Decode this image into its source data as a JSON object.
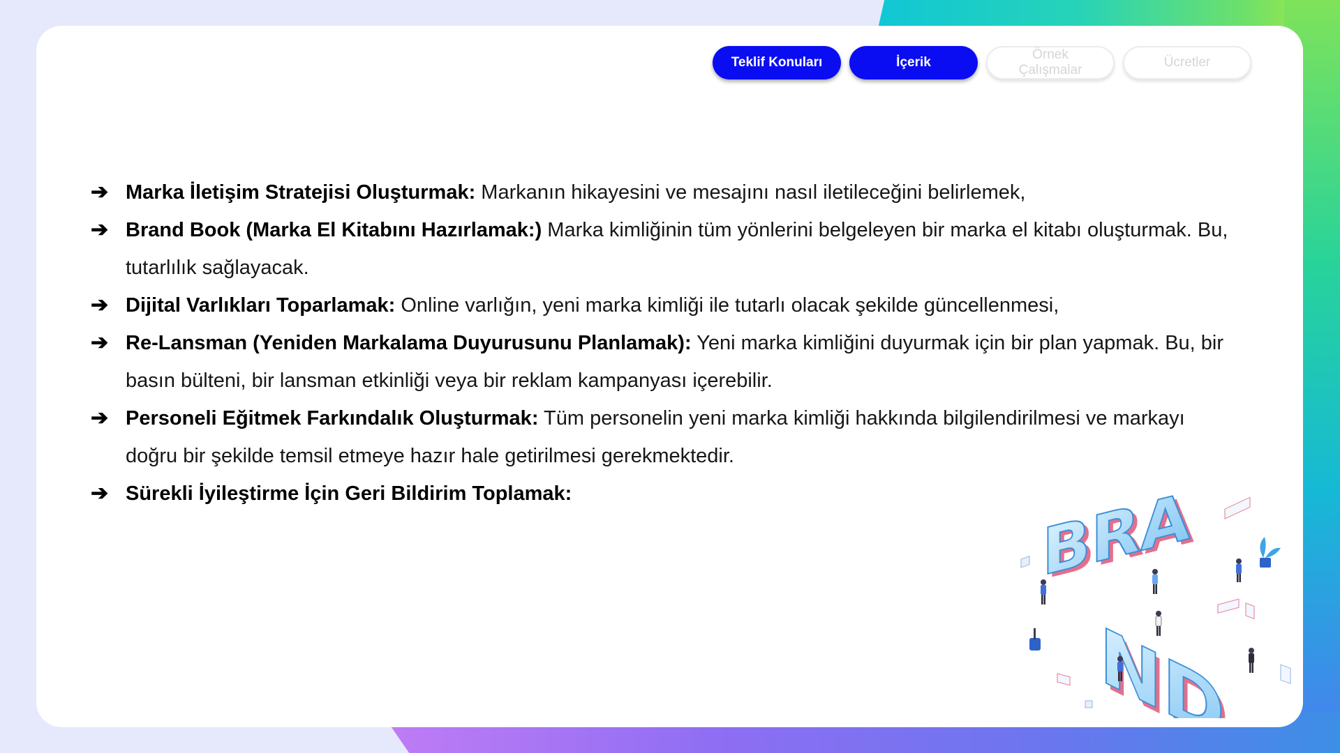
{
  "nav": {
    "tabs": [
      {
        "label": "Teklif Konuları",
        "active": true
      },
      {
        "label": "İçerik",
        "active": true
      },
      {
        "label": "Örnek\nÇalışmalar",
        "active": false
      },
      {
        "label": "Ücretler",
        "active": false
      }
    ]
  },
  "content": {
    "items": [
      {
        "bold": "Marka İletişim Stratejisi Oluşturmak:",
        "text": " Markanın hikayesini ve mesajını nasıl iletileceğini belirlemek,"
      },
      {
        "bold": "Brand Book (Marka El Kitabını Hazırlamak:)",
        "text": " Marka kimliğinin tüm yönlerini belgeleyen bir marka el kitabı oluşturmak. Bu, tutarlılık sağlayacak."
      },
      {
        "bold": "Dijital Varlıkları Toparlamak:",
        "text": " Online varlığın, yeni marka kimliği ile tutarlı olacak şekilde güncellenmesi,"
      },
      {
        "bold": "Re-Lansman (Yeniden Markalama Duyurusunu Planlamak):",
        "text": " Yeni marka kimliğini duyurmak için bir plan yapmak. Bu, bir basın bülteni, bir lansman etkinliği veya bir reklam kampanyası içerebilir."
      },
      {
        "bold": "Personeli Eğitmek Farkındalık Oluşturmak:",
        "text": " Tüm personelin yeni marka kimliği hakkında bilgilendirilmesi ve markayı doğru bir şekilde temsil etmeye hazır hale getirilmesi gerekmektedir."
      },
      {
        "bold": "Sürekli İyileştirme İçin Geri Bildirim Toplamak:",
        "text": ""
      }
    ],
    "bullet_icon": "arrow-right-icon"
  },
  "illustration": {
    "letters_top": "BRA",
    "letters_bottom": "ND"
  },
  "colors": {
    "accent": "#0a0df2",
    "inactive_text": "#d6d6d6",
    "card": "#ffffff"
  }
}
